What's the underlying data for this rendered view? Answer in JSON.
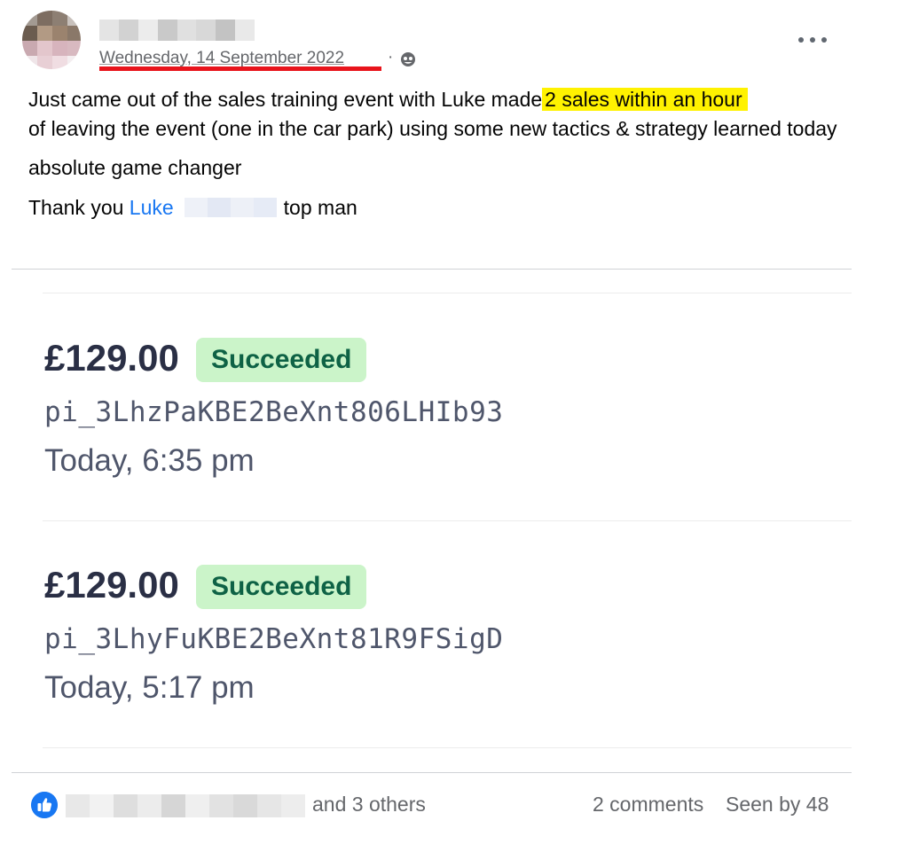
{
  "post": {
    "date": "Wednesday, 14 September 2022",
    "separator": "·",
    "text_intro": "Just came out of the sales training event with Luke made",
    "text_highlight": "2 sales within an hour",
    "text_rest": "of leaving the event (one in the car park) using some new tactics & strategy learned today",
    "line2": "absolute game changer",
    "thanks_prefix": "Thank you",
    "mention_name": "Luke",
    "thanks_suffix": "top man"
  },
  "payments": [
    {
      "amount": "£129.00",
      "status": "Succeeded",
      "id": "pi_3LhzPaKBE2BeXnt806LHIb93",
      "time": "Today, 6:35 pm"
    },
    {
      "amount": "£129.00",
      "status": "Succeeded",
      "id": "pi_3LhyFuKBE2BeXnt81R9FSigD",
      "time": "Today, 5:17 pm"
    }
  ],
  "footer": {
    "reactions_suffix": "and 3 others",
    "comments": "2 comments",
    "seen": "Seen by 48"
  },
  "colors": {
    "highlight": "#fff200",
    "mention": "#1877f2",
    "badge_bg": "#cbf4c9",
    "badge_text": "#0e6245",
    "date_underline": "#e8141c"
  },
  "icons": [
    "globe-icon",
    "more-options-icon",
    "like-reaction-icon"
  ]
}
